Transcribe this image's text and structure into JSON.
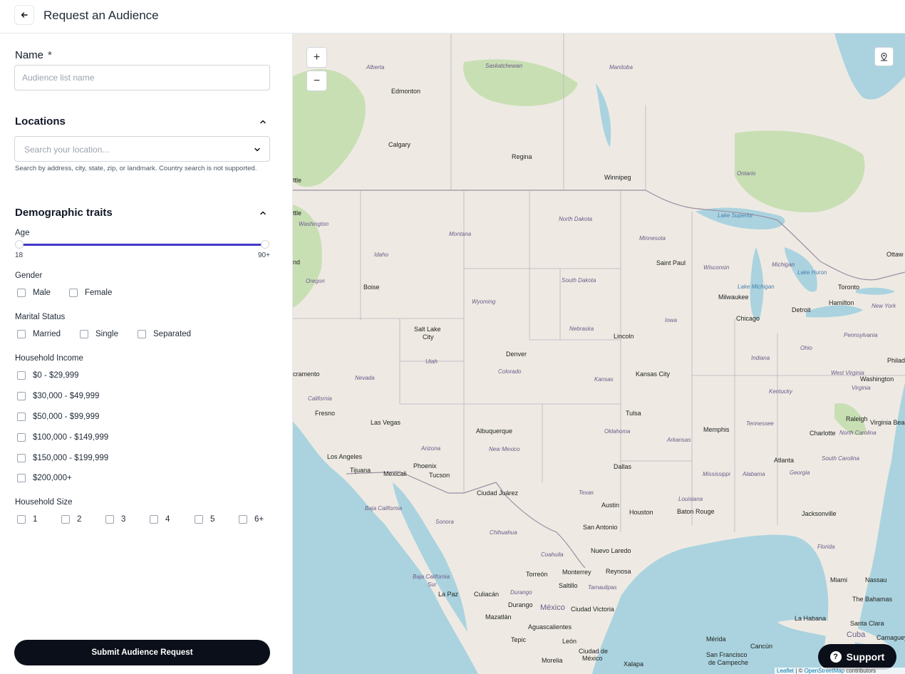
{
  "header": {
    "back_icon": "arrow-left-icon",
    "title": "Request an Audience"
  },
  "name_field": {
    "label": "Name",
    "required_mark": "*",
    "placeholder": "Audience list name",
    "value": ""
  },
  "locations": {
    "title": "Locations",
    "collapse_icon": "chevron-up-icon",
    "search_placeholder": "Search your location...",
    "dropdown_icon": "chevron-down-icon",
    "helper": "Search by address, city, state, zip, or landmark. Country search is not supported."
  },
  "demographics": {
    "title": "Demographic traits",
    "collapse_icon": "chevron-up-icon",
    "age": {
      "label": "Age",
      "min_label": "18",
      "max_label": "90+",
      "min_value": 18,
      "max_value": 90,
      "track_color": "#4338ca"
    },
    "gender": {
      "label": "Gender",
      "options": [
        "Male",
        "Female"
      ]
    },
    "marital_status": {
      "label": "Marital Status",
      "options": [
        "Married",
        "Single",
        "Separated"
      ]
    },
    "household_income": {
      "label": "Household Income",
      "options": [
        "$0 - $29,999",
        "$30,000 - $49,999",
        "$50,000 - $99,999",
        "$100,000 - $149,999",
        "$150,000 - $199,999",
        "$200,000+"
      ]
    },
    "household_size": {
      "label": "Household Size",
      "options": [
        "1",
        "2",
        "3",
        "4",
        "5",
        "6+"
      ]
    }
  },
  "submit_label": "Submit Audience Request",
  "map": {
    "zoom_in": "+",
    "zoom_out": "−",
    "locate_icon": "map-pin-icon",
    "support_label": "Support",
    "support_icon": "question-circle-icon",
    "attribution": {
      "leaflet": "Leaflet",
      "sep": " | © ",
      "osm": "OpenStreetMap",
      "suffix": " contributors"
    },
    "labels": {
      "alberta": "Alberta",
      "saskatchewan": "Saskatchewan",
      "manitoba": "Manitoba",
      "ontario": "Ontario",
      "edmonton": "Edmonton",
      "calgary": "Calgary",
      "regina": "Regina",
      "winnipeg": "Winnipeg",
      "washington_state": "Washington",
      "seattle_frag": "ttle",
      "portland_frag": "nd",
      "sacramento_frag": "cramento",
      "oregon": "Oregon",
      "idaho": "Idaho",
      "montana": "Montana",
      "north_dakota": "North Dakota",
      "south_dakota": "South Dakota",
      "minnesota": "Minnesota",
      "wisconsin": "Wisconsin",
      "michigan": "Michigan",
      "wyoming": "Wyoming",
      "nebraska": "Nebraska",
      "iowa": "Iowa",
      "utah": "Utah",
      "colorado": "Colorado",
      "kansas": "Kansas",
      "nevada": "Nevada",
      "california": "California",
      "arizona": "Arizona",
      "new_mexico": "New Mexico",
      "oklahoma": "Oklahoma",
      "texas": "Texas",
      "arkansas": "Arkansas",
      "louisiana": "Louisiana",
      "mississippi": "Mississippi",
      "alabama": "Alabama",
      "georgia": "Georgia",
      "florida": "Florida",
      "tennessee": "Tennessee",
      "kentucky": "Kentucky",
      "indiana": "Indiana",
      "ohio": "Ohio",
      "pennsylvania": "Pennsylvania",
      "new_york": "New York",
      "west_virginia": "West Virginia",
      "virginia": "Virginia",
      "north_carolina": "North Carolina",
      "south_carolina": "South Carolina",
      "lake_superior": "Lake Superior",
      "lake_michigan": "Lake Michigan",
      "lake_huron": "Lake Huron",
      "boise": "Boise",
      "salt_lake_city_1": "Salt Lake",
      "salt_lake_city_2": "City",
      "denver": "Denver",
      "lincoln": "Lincoln",
      "saint_paul": "Saint Paul",
      "milwaukee": "Milwaukee",
      "chicago": "Chicago",
      "detroit": "Detroit",
      "toronto": "Toronto",
      "hamilton": "Hamilton",
      "ottawa_frag": "Ottaw",
      "philadelphia_frag": "Philad",
      "washington_dc": "Washington",
      "virginia_beach": "Virginia Beac",
      "raleigh": "Raleigh",
      "charlotte": "Charlotte",
      "kansas_city": "Kansas City",
      "tulsa": "Tulsa",
      "memphis": "Memphis",
      "atlanta": "Atlanta",
      "dallas": "Dallas",
      "austin": "Austin",
      "houston": "Houston",
      "baton_rouge": "Baton Rouge",
      "jacksonville": "Jacksonville",
      "san_antonio": "San Antonio",
      "fresno": "Fresno",
      "las_vegas": "Las Vegas",
      "los_angeles": "Los Angeles",
      "tijuana": "Tijuana",
      "mexicali": "Mexicali",
      "phoenix": "Phoenix",
      "tucson": "Tucson",
      "albuquerque": "Albuquerque",
      "ciudad_juarez": "Ciudad Juárez",
      "baja_california": "Baja California",
      "sonora": "Sonora",
      "chihuahua": "Chihuahua",
      "coahuila": "Coahuila",
      "nuevo_laredo": "Nuevo Laredo",
      "torreon": "Torreón",
      "monterrey": "Monterrey",
      "reynosa": "Reynosa",
      "saltillo": "Saltillo",
      "tamaulipas": "Tamaulipas",
      "baja_california_sur_1": "Baja California",
      "baja_california_sur_2": "Sur",
      "la_paz": "La Paz",
      "culiacan": "Culiacán",
      "durango_state": "Durango",
      "durango_city": "Durango",
      "mexico": "México",
      "ciudad_victoria": "Ciudad Victoria",
      "mazatlan": "Mazatlán",
      "aguascalientes": "Aguascalientes",
      "tepic": "Tepic",
      "leon": "León",
      "morelia": "Morelia",
      "ciudad_de_mexico_1": "Ciudad de",
      "ciudad_de_mexico_2": "México",
      "xalapa": "Xalapa",
      "merida": "Mérida",
      "cancun": "Cancún",
      "san_francisco_campeche_1": "San Francisco",
      "san_francisco_campeche_2": "de Campeche",
      "miami": "Miami",
      "nassau": "Nassau",
      "the_bahamas": "The Bahamas",
      "la_habana": "La Habana",
      "santa_clara": "Santa Clara",
      "cuba": "Cuba",
      "camaguey": "Camaguey"
    }
  }
}
